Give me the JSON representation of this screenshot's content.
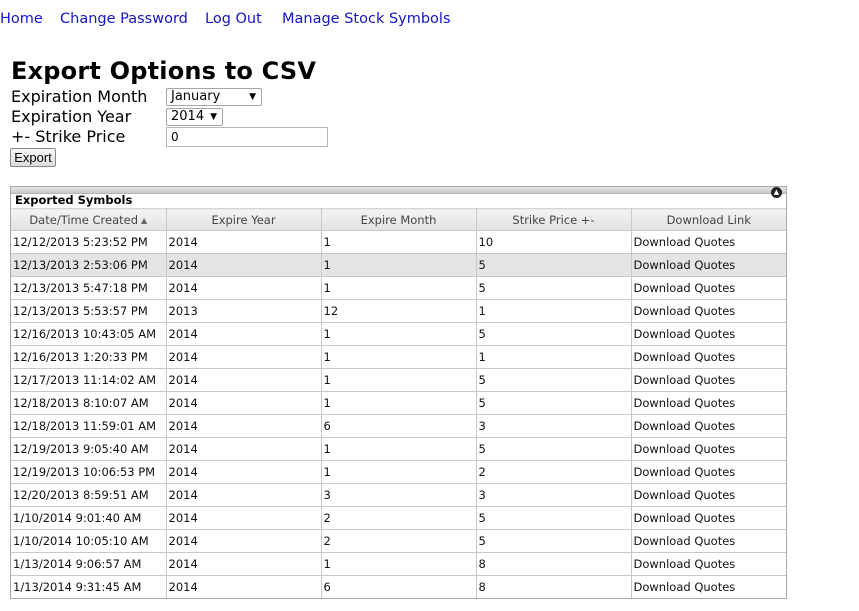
{
  "nav": {
    "home": "Home",
    "change_password": "Change Password",
    "log_out": "Log Out",
    "manage_symbols": "Manage Stock Symbols"
  },
  "page": {
    "title": "Export Options to CSV"
  },
  "form": {
    "month_label": "Expiration Month",
    "month_value": "January",
    "year_label": "Expiration Year",
    "year_value": "2014",
    "strike_label": "+- Strike Price",
    "strike_value": "0",
    "export_label": "Export"
  },
  "grid": {
    "caption": "Exported Symbols",
    "sort_column": "Date/Time Created",
    "sort_direction": "ascending",
    "headers": [
      "Date/Time Created",
      "Expire Year",
      "Expire Month",
      "Strike Price +-",
      "Download Link"
    ],
    "selected_row": 1,
    "rows": [
      [
        "12/12/2013 5:23:52 PM",
        "2014",
        "1",
        "10",
        "Download Quotes"
      ],
      [
        "12/13/2013 2:53:06 PM",
        "2014",
        "1",
        "5",
        "Download Quotes"
      ],
      [
        "12/13/2013 5:47:18 PM",
        "2014",
        "1",
        "5",
        "Download Quotes"
      ],
      [
        "12/13/2013 5:53:57 PM",
        "2013",
        "12",
        "1",
        "Download Quotes"
      ],
      [
        "12/16/2013 10:43:05 AM",
        "2014",
        "1",
        "5",
        "Download Quotes"
      ],
      [
        "12/16/2013 1:20:33 PM",
        "2014",
        "1",
        "1",
        "Download Quotes"
      ],
      [
        "12/17/2013 11:14:02 AM",
        "2014",
        "1",
        "5",
        "Download Quotes"
      ],
      [
        "12/18/2013 8:10:07 AM",
        "2014",
        "1",
        "5",
        "Download Quotes"
      ],
      [
        "12/18/2013 11:59:01 AM",
        "2014",
        "6",
        "3",
        "Download Quotes"
      ],
      [
        "12/19/2013 9:05:40 AM",
        "2014",
        "1",
        "5",
        "Download Quotes"
      ],
      [
        "12/19/2013 10:06:53 PM",
        "2014",
        "1",
        "2",
        "Download Quotes"
      ],
      [
        "12/20/2013 8:59:51 AM",
        "2014",
        "3",
        "3",
        "Download Quotes"
      ],
      [
        "1/10/2014 9:01:40 AM",
        "2014",
        "2",
        "5",
        "Download Quotes"
      ],
      [
        "1/10/2014 10:05:10 AM",
        "2014",
        "2",
        "5",
        "Download Quotes"
      ],
      [
        "1/13/2014 9:06:57 AM",
        "2014",
        "1",
        "8",
        "Download Quotes"
      ],
      [
        "1/13/2014 9:31:45 AM",
        "2014",
        "6",
        "8",
        "Download Quotes"
      ]
    ]
  },
  "icons": {
    "dropdown": "chevron-down-icon",
    "sort": "sort-ascending-icon",
    "collapse": "collapse-icon"
  }
}
